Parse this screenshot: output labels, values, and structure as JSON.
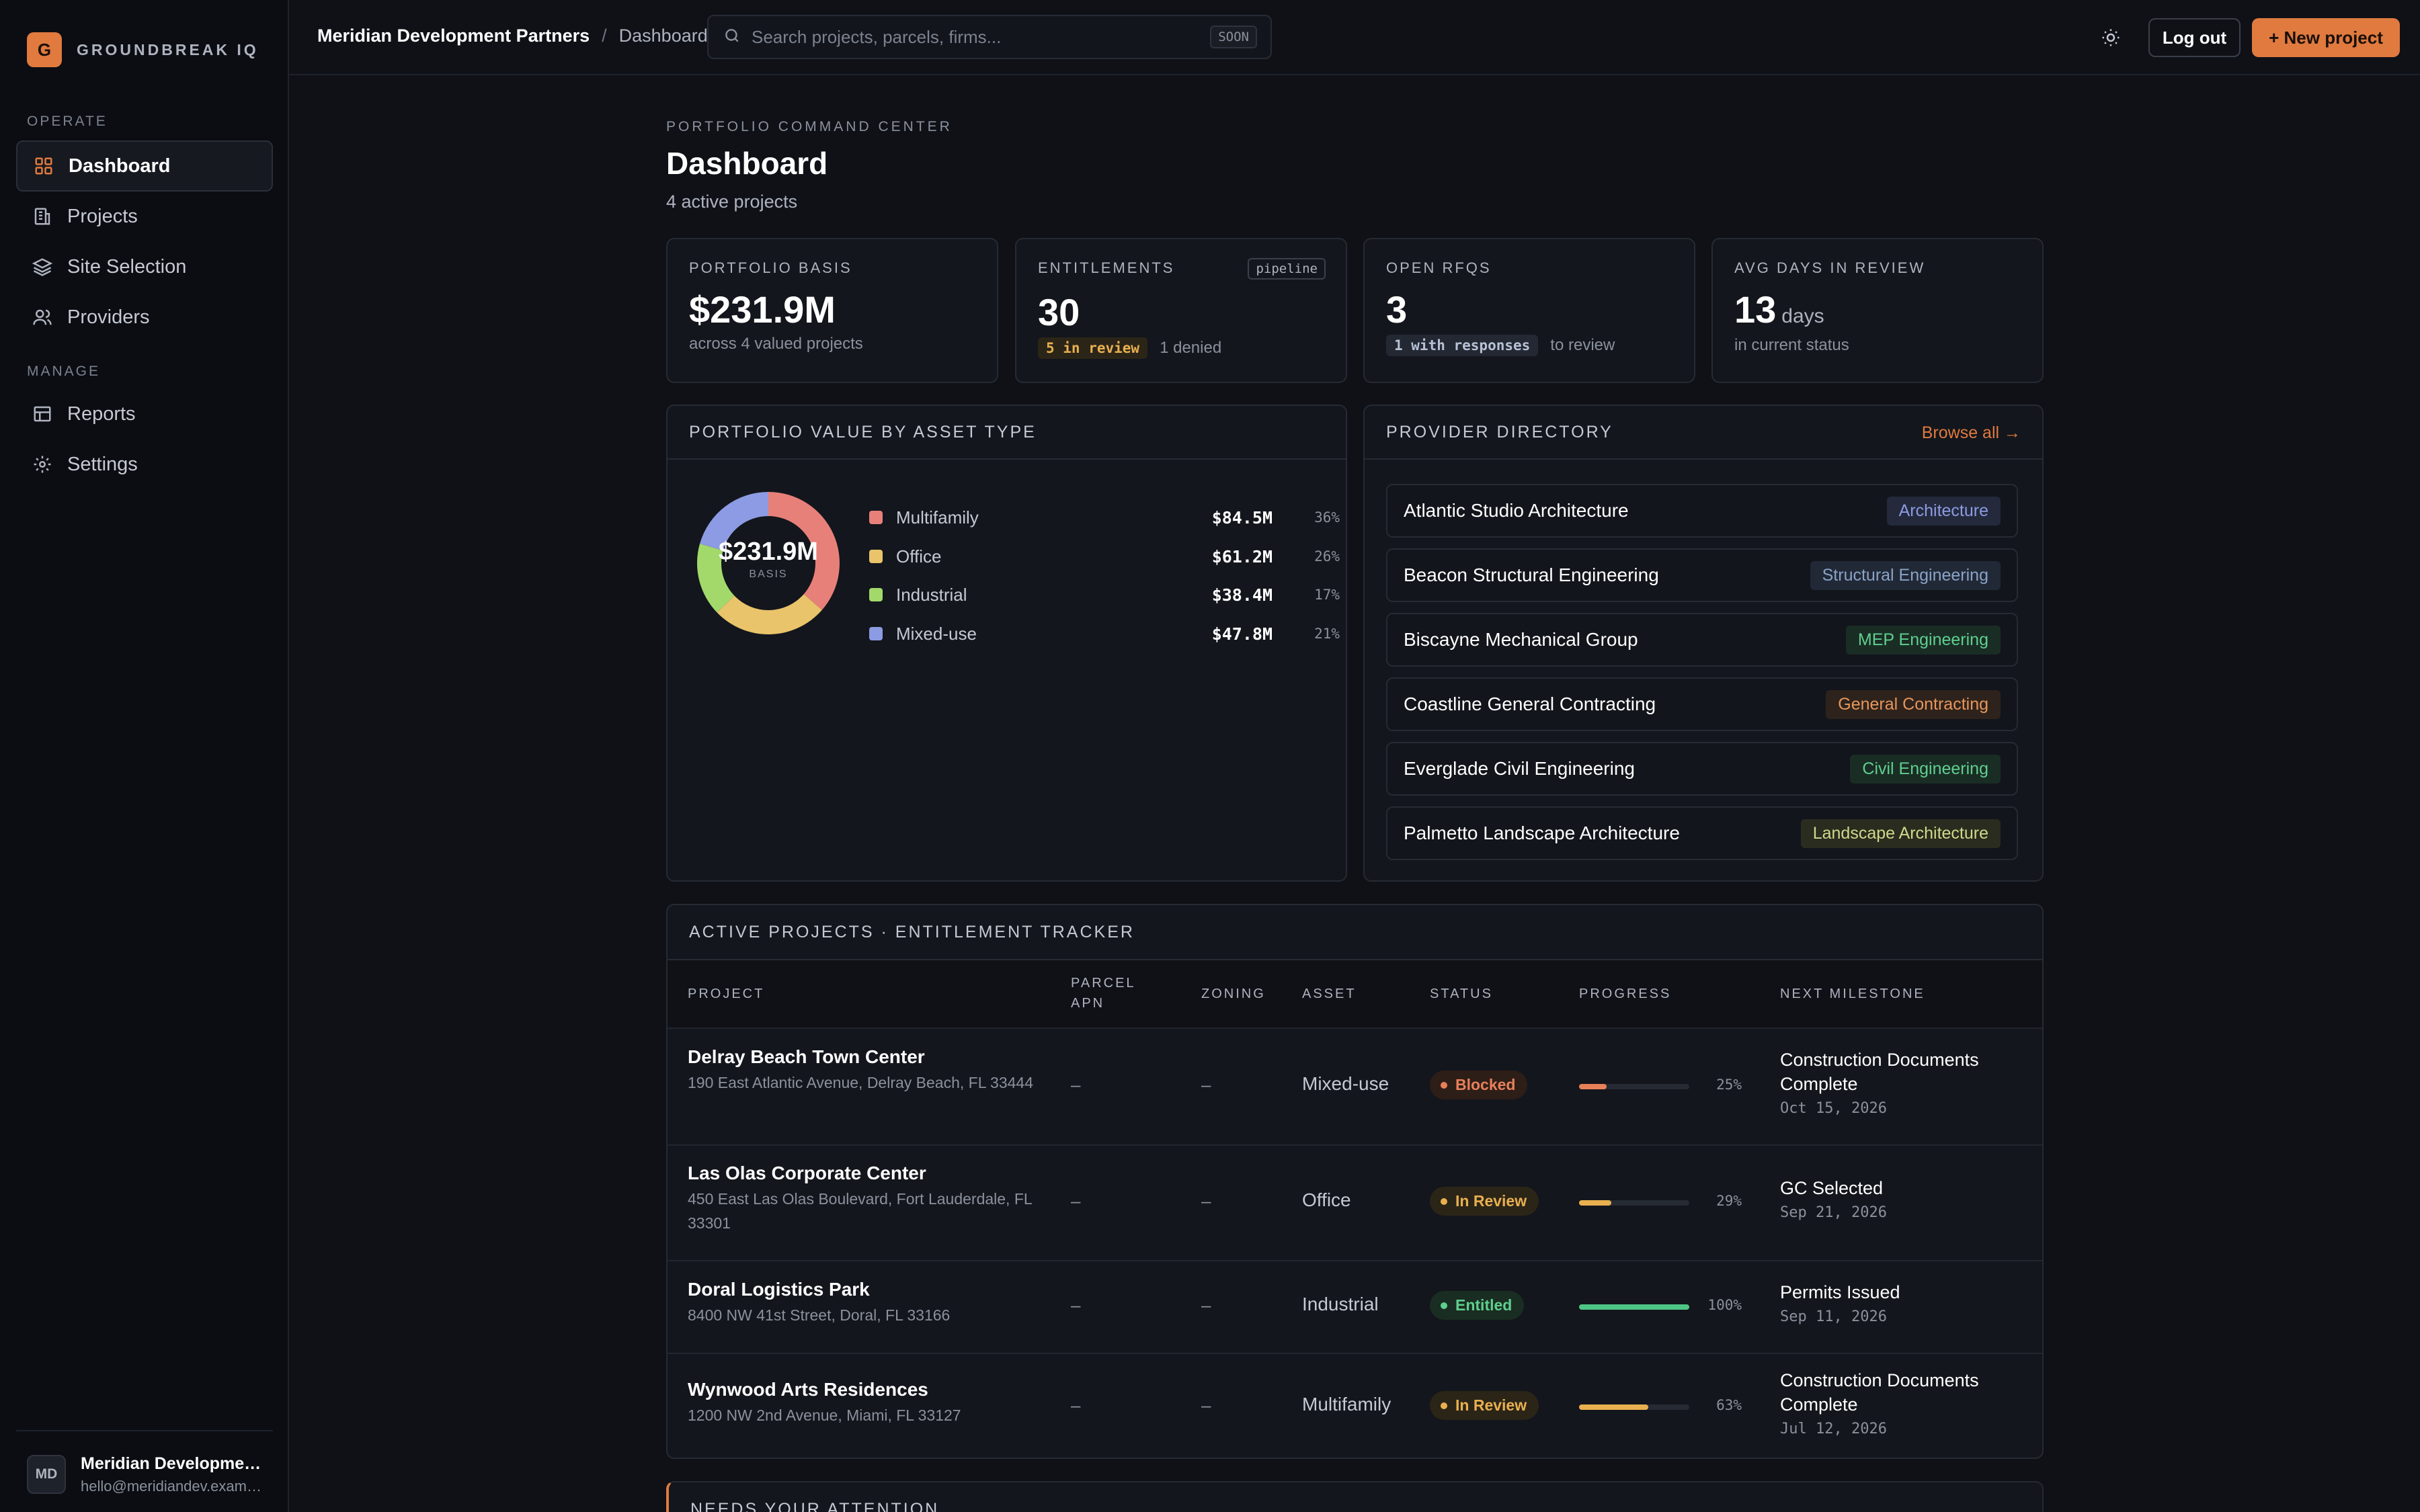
{
  "brand": {
    "logo_letter": "G",
    "name": "GROUNDBREAK IQ",
    "accent": "#e07a3f"
  },
  "sidebar": {
    "sections": [
      {
        "label": "OPERATE"
      },
      {
        "label": "MANAGE"
      }
    ],
    "items": [
      {
        "label": "Dashboard",
        "icon": "grid-icon",
        "active": true
      },
      {
        "label": "Projects",
        "icon": "building-icon"
      },
      {
        "label": "Site Selection",
        "icon": "layers-icon"
      },
      {
        "label": "Providers",
        "icon": "users-icon"
      },
      {
        "label": "Reports",
        "icon": "table-icon"
      },
      {
        "label": "Settings",
        "icon": "gear-icon"
      }
    ],
    "user": {
      "initials": "MD",
      "name": "Meridian Development Partners",
      "email": "hello@meridiandev.example"
    }
  },
  "topbar": {
    "org": "Meridian Development Partners",
    "separator": "/",
    "page": "Dashboard",
    "search_placeholder": "Search projects, parcels, firms...",
    "search_badge": "SOON",
    "logout_label": "Log out",
    "new_project_label": "+ New project"
  },
  "header": {
    "eyebrow": "PORTFOLIO COMMAND CENTER",
    "title": "Dashboard",
    "subtitle": "4 active projects"
  },
  "kpis": {
    "basis": {
      "label": "PORTFOLIO BASIS",
      "value": "$231.9M",
      "note": "across 4 valued projects"
    },
    "entitlements": {
      "label": "ENTITLEMENTS",
      "tag": "pipeline",
      "value": "30",
      "pill": "5 in review",
      "note": "1 denied"
    },
    "rfqs": {
      "label": "OPEN RFQS",
      "value": "3",
      "pill": "1 with responses",
      "note": "to review"
    },
    "review": {
      "label": "AVG DAYS IN REVIEW",
      "value": "13",
      "unit": "days",
      "note": "in current status"
    }
  },
  "asset_panel": {
    "title": "PORTFOLIO VALUE BY ASSET TYPE",
    "center_value": "$231.9M",
    "center_label": "BASIS"
  },
  "chart_data": {
    "type": "pie",
    "title": "PORTFOLIO VALUE BY ASSET TYPE",
    "categories": [
      "Multifamily",
      "Office",
      "Industrial",
      "Mixed-use"
    ],
    "values": [
      84.5,
      61.2,
      38.4,
      47.8
    ],
    "value_labels": [
      "$84.5M",
      "$61.2M",
      "$38.4M",
      "$47.8M"
    ],
    "percent_labels": [
      "36%",
      "26%",
      "17%",
      "21%"
    ],
    "colors": [
      "#e8807a",
      "#e9c46a",
      "#a3d96b",
      "#8c9be3"
    ],
    "donut": true
  },
  "providers": {
    "title": "PROVIDER DIRECTORY",
    "browse_label": "Browse all →",
    "items": [
      {
        "name": "Atlantic Studio Architecture",
        "tag": "Architecture",
        "color": "#8c9be3",
        "bg": "#242a3c"
      },
      {
        "name": "Beacon Structural Engineering",
        "tag": "Structural Engineering",
        "color": "#8aa3c8",
        "bg": "#222936"
      },
      {
        "name": "Biscayne Mechanical Group",
        "tag": "MEP Engineering",
        "color": "#5fcf8e",
        "bg": "#1a2d25"
      },
      {
        "name": "Coastline General Contracting",
        "tag": "General Contracting",
        "color": "#e8965a",
        "bg": "#2e231c"
      },
      {
        "name": "Everglade Civil Engineering",
        "tag": "Civil Engineering",
        "color": "#5fcf8e",
        "bg": "#1a2d25"
      },
      {
        "name": "Palmetto Landscape Architecture",
        "tag": "Landscape Architecture",
        "color": "#cfd98a",
        "bg": "#2a2c1f"
      }
    ]
  },
  "tracker": {
    "title": "ACTIVE PROJECTS · ENTITLEMENT TRACKER",
    "columns": [
      "PROJECT",
      "PARCEL APN",
      "ZONING",
      "ASSET",
      "STATUS",
      "PROGRESS",
      "NEXT MILESTONE"
    ],
    "rows": [
      {
        "name": "Delray Beach Town Center",
        "address": "190 East Atlantic Avenue, Delray Beach, FL 33444",
        "apn": "–",
        "zoning": "–",
        "asset": "Mixed-use",
        "status": "Blocked",
        "status_color": "#e8805a",
        "status_bg": "#2e1e18",
        "progress": 25,
        "progress_label": "25%",
        "progress_color": "#e8805a",
        "milestone": "Construction Documents Complete",
        "milestone_date": "Oct 15, 2026"
      },
      {
        "name": "Las Olas Corporate Center",
        "address": "450 East Las Olas Boulevard, Fort Lauderdale, FL 33301",
        "apn": "–",
        "zoning": "–",
        "asset": "Office",
        "status": "In Review",
        "status_color": "#e9b04f",
        "status_bg": "#2b2518",
        "progress": 29,
        "progress_label": "29%",
        "progress_color": "#e9b04f",
        "milestone": "GC Selected",
        "milestone_date": "Sep 21, 2026"
      },
      {
        "name": "Doral Logistics Park",
        "address": "8400 NW 41st Street, Doral, FL 33166",
        "apn": "–",
        "zoning": "–",
        "asset": "Industrial",
        "status": "Entitled",
        "status_color": "#5fcf8e",
        "status_bg": "#1a2d22",
        "progress": 100,
        "progress_label": "100%",
        "progress_color": "#4fc585",
        "milestone": "Permits Issued",
        "milestone_date": "Sep 11, 2026"
      },
      {
        "name": "Wynwood Arts Residences",
        "address": "1200 NW 2nd Avenue, Miami, FL 33127",
        "apn": "–",
        "zoning": "–",
        "asset": "Multifamily",
        "status": "In Review",
        "status_color": "#e9b04f",
        "status_bg": "#2b2518",
        "progress": 63,
        "progress_label": "63%",
        "progress_color": "#e9b04f",
        "milestone": "Construction Documents Complete",
        "milestone_date": "Jul 12, 2026"
      }
    ]
  },
  "attention": {
    "title": "NEEDS YOUR ATTENTION"
  }
}
